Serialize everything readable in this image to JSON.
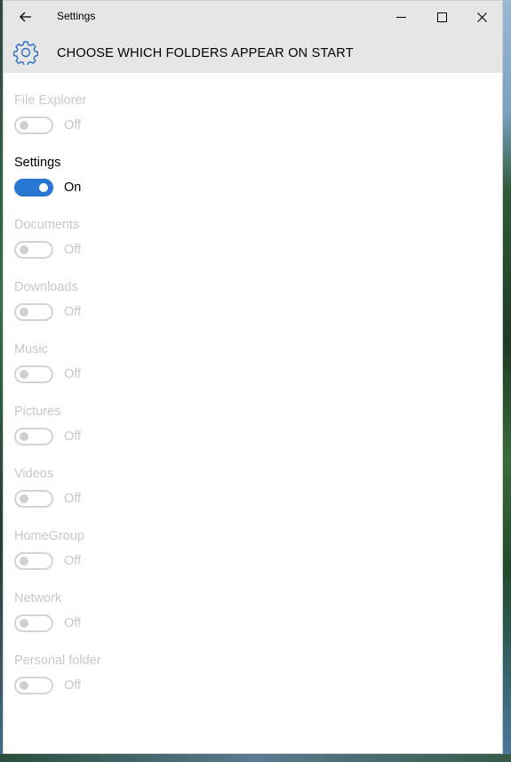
{
  "window": {
    "app_title": "Settings",
    "page_title": "CHOOSE WHICH FOLDERS APPEAR ON START"
  },
  "icons": {
    "back": "back-arrow-icon",
    "minimize": "minimize-icon",
    "maximize": "maximize-icon",
    "close": "close-icon",
    "header": "gear-icon"
  },
  "colors": {
    "accent": "#2777d2",
    "disabled_text": "#c8c8c8",
    "header_bg": "#e6e6e6"
  },
  "folders": [
    {
      "label": "File Explorer",
      "state": "Off",
      "on": false
    },
    {
      "label": "Settings",
      "state": "On",
      "on": true
    },
    {
      "label": "Documents",
      "state": "Off",
      "on": false
    },
    {
      "label": "Downloads",
      "state": "Off",
      "on": false
    },
    {
      "label": "Music",
      "state": "Off",
      "on": false
    },
    {
      "label": "Pictures",
      "state": "Off",
      "on": false
    },
    {
      "label": "Videos",
      "state": "Off",
      "on": false
    },
    {
      "label": "HomeGroup",
      "state": "Off",
      "on": false
    },
    {
      "label": "Network",
      "state": "Off",
      "on": false
    },
    {
      "label": "Personal folder",
      "state": "Off",
      "on": false
    }
  ]
}
